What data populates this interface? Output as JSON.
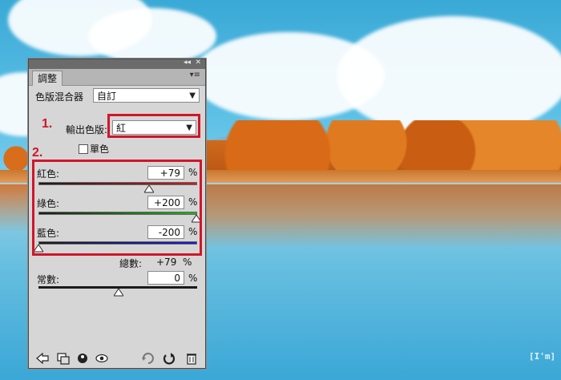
{
  "photo": {
    "watermark": "[I'm]"
  },
  "panel": {
    "tab_label": "調整",
    "preset_label": "色版混合器",
    "preset_value": "自訂",
    "output_channel_label": "輸出色版:",
    "output_channel_value": "紅",
    "monochrome_label": "單色",
    "monochrome_checked": false,
    "channels": [
      {
        "label": "紅色:",
        "value": "+79",
        "unit": "%",
        "level_pct": 79
      },
      {
        "label": "綠色:",
        "value": "+200",
        "unit": "%",
        "level_pct": 200
      },
      {
        "label": "藍色:",
        "value": "-200",
        "unit": "%",
        "level_pct": -200
      }
    ],
    "total_label": "總數:",
    "total_value": "+79",
    "total_unit": "%",
    "constant_label": "常數:",
    "constant_value": "0",
    "constant_unit": "%",
    "constant_level_pct": 0
  },
  "annotations": {
    "step1": "1.",
    "step2": "2."
  },
  "colors": {
    "annotation_red": "#d0162a",
    "panel_bg": "#d6d6d6"
  },
  "icons": [
    "back-arrow-icon",
    "clip-to-layer-icon",
    "toggle-layer-visibility-icon",
    "view-previous-state-icon",
    "reset-icon",
    "refresh-icon",
    "trash-icon"
  ]
}
